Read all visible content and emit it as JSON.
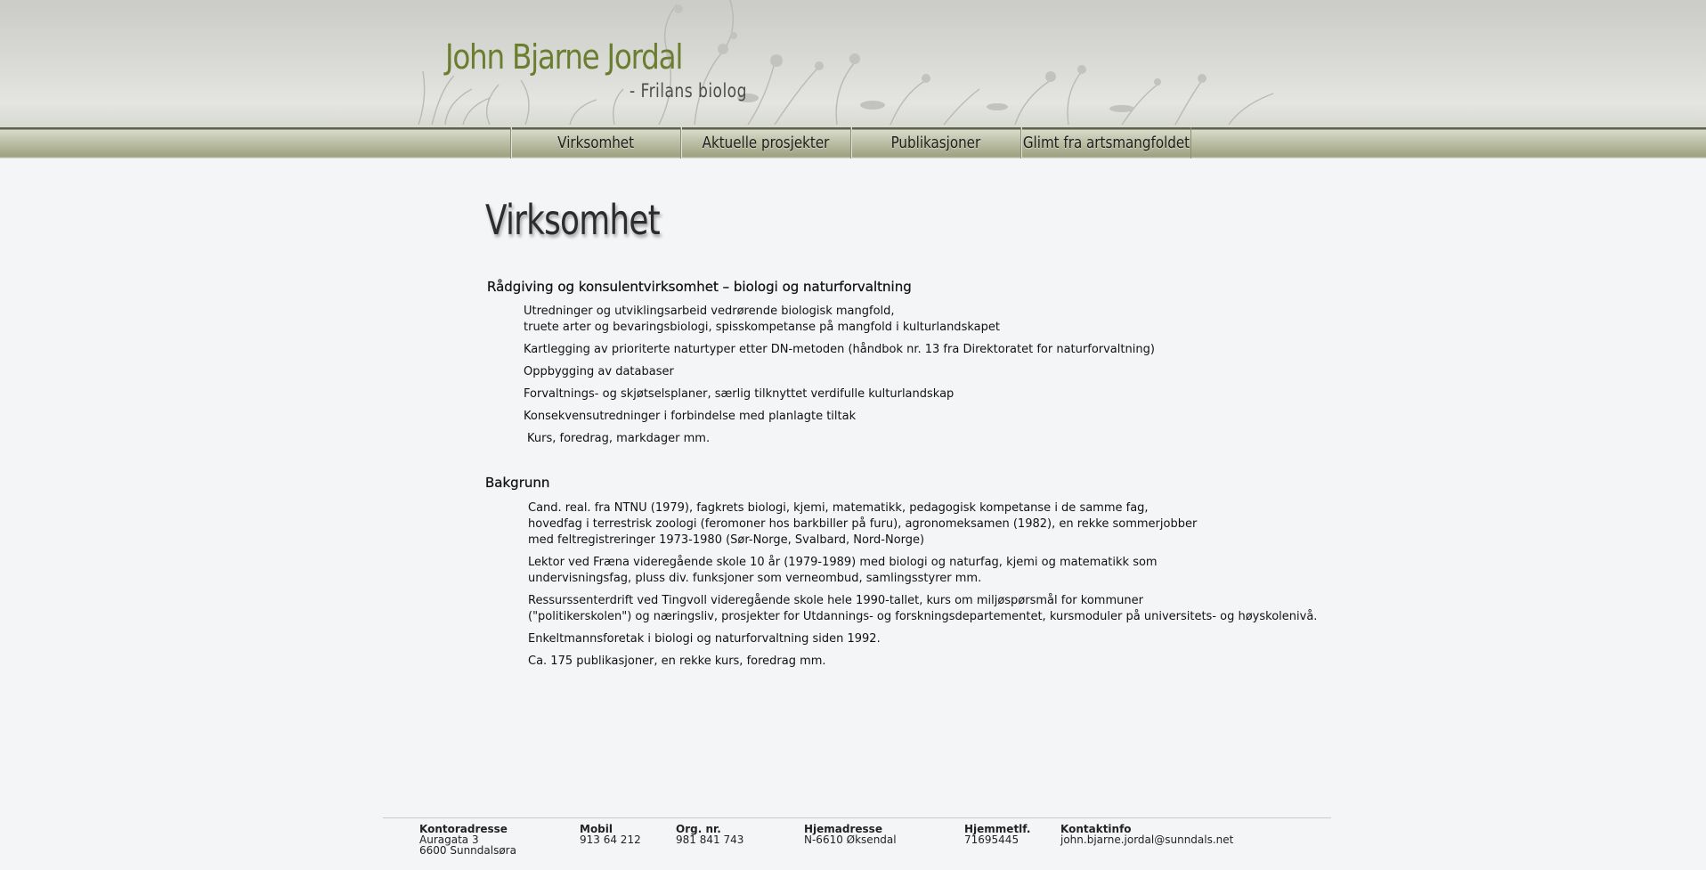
{
  "header": {
    "title": "John Bjarne Jordal",
    "subtitle": "- Frilans biolog"
  },
  "nav": {
    "items": [
      {
        "label": "Virksomhet"
      },
      {
        "label": "Aktuelle prosjekter"
      },
      {
        "label": "Publikasjoner"
      },
      {
        "label": "Glimt fra artsmangfoldet"
      }
    ]
  },
  "main": {
    "title": "Virksomhet",
    "section1": {
      "heading": "Rådgiving og konsulentvirksomhet – biologi og naturforvaltning",
      "lines": [
        "Utredninger og utviklingsarbeid vedrørende biologisk mangfold,",
        "truete arter og bevaringsbiologi, spisskompetanse på mangfold i kulturlandskapet",
        "Kartlegging av prioriterte naturtyper etter DN-metoden (håndbok nr. 13 fra Direktoratet for naturforvaltning)",
        "Oppbygging av databaser",
        "Forvaltnings- og skjøtselsplaner, særlig tilknyttet verdifulle kulturlandskap",
        "Konsekvensutredninger i forbindelse med planlagte tiltak",
        "Kurs, foredrag, markdager mm."
      ]
    },
    "section2": {
      "heading": "Bakgrunn",
      "lines": [
        "Cand. real. fra NTNU (1979), fagkrets biologi, kjemi, matematikk, pedagogisk kompetanse i de samme fag,",
        "hovedfag i terrestrisk zoologi (feromoner hos barkbiller på furu), agronomeksamen (1982), en rekke sommerjobber",
        "med feltregistreringer 1973-1980 (Sør-Norge, Svalbard, Nord-Norge)",
        "Lektor ved Fræna videregående skole 10 år (1979-1989) med biologi og naturfag, kjemi og matematikk som",
        "undervisningsfag, pluss div. funksjoner som verneombud, samlingsstyrer mm.",
        "Ressurssenterdrift ved Tingvoll videregående skole hele 1990-tallet, kurs om miljøspørsmål for kommuner",
        "(\"politikerskolen\") og næringsliv, prosjekter for Utdannings- og forskningsdepartementet, kursmoduler på universitets- og høyskolenivå.",
        "Enkeltmannsforetak i biologi og naturforvaltning siden 1992.",
        "Ca. 175 publikasjoner, en rekke kurs, foredrag mm."
      ]
    }
  },
  "footer": {
    "office": {
      "label": "Kontoradresse",
      "line1": "Auragata 3",
      "line2": "6600 Sunndalsøra"
    },
    "mobile": {
      "label": "Mobil",
      "value": "913 64 212"
    },
    "org": {
      "label": "Org. nr.",
      "value": "981 841 743"
    },
    "home": {
      "label": "Hjemadresse",
      "value": "N-6610 Øksendal"
    },
    "homephone": {
      "label": "Hjemmetlf.",
      "value": "71695445"
    },
    "contact": {
      "label": "Kontaktinfo",
      "value": "john.bjarne.jordal@sunndals.net"
    }
  }
}
